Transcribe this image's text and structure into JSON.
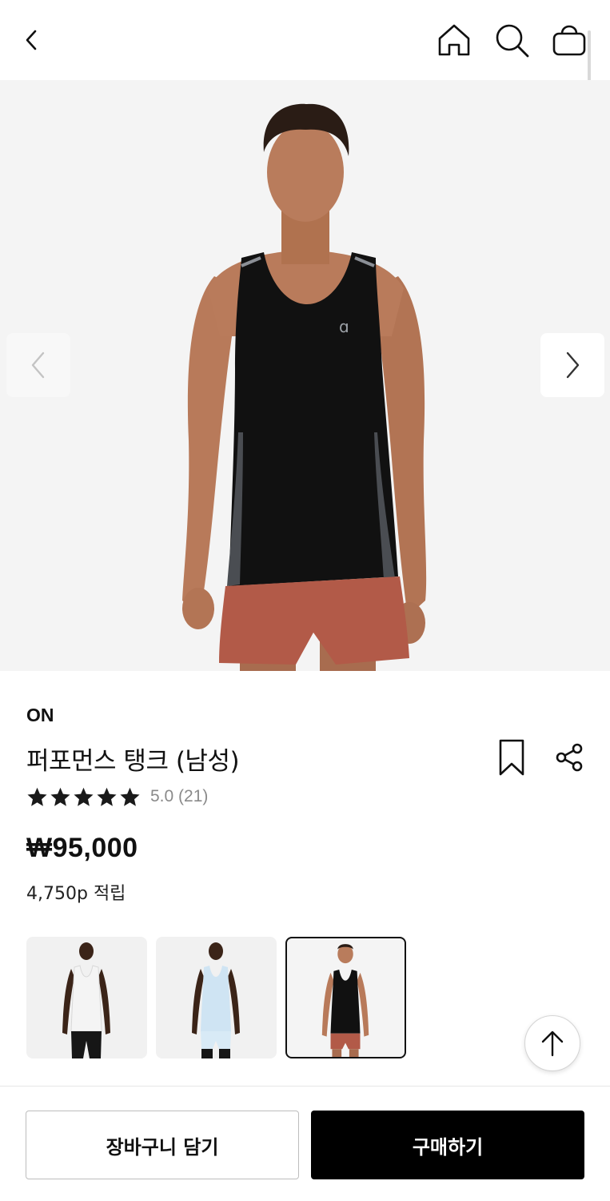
{
  "header": {
    "icons": [
      "back-chevron-icon",
      "home-icon",
      "search-icon",
      "shopping-bag-icon"
    ]
  },
  "gallery": {
    "prev_icon": "chevron-left-icon",
    "next_icon": "chevron-right-icon",
    "image": "model-black-tank-front"
  },
  "product": {
    "brand": "ON",
    "name": "퍼포먼스 탱크 (남성)",
    "rating_stars": 5,
    "rating_text": "5.0 (21)",
    "price": "₩95,000",
    "points": "4,750p 적립",
    "bookmark_icon": "bookmark-icon",
    "share_icon": "share-icon"
  },
  "color_options": [
    {
      "name": "white-tank",
      "selected": false
    },
    {
      "name": "light-blue-tank",
      "selected": false
    },
    {
      "name": "black-tank",
      "selected": true
    }
  ],
  "colors": {
    "hero_bg": "#f4f4f4",
    "tank": "#111111",
    "shorts": "#b25a48",
    "skin": "#b87a5a",
    "buy_bg": "#000000"
  },
  "actions": {
    "add_to_cart": "장바구니 담기",
    "buy_now": "구매하기",
    "scroll_top_icon": "arrow-up-icon"
  }
}
